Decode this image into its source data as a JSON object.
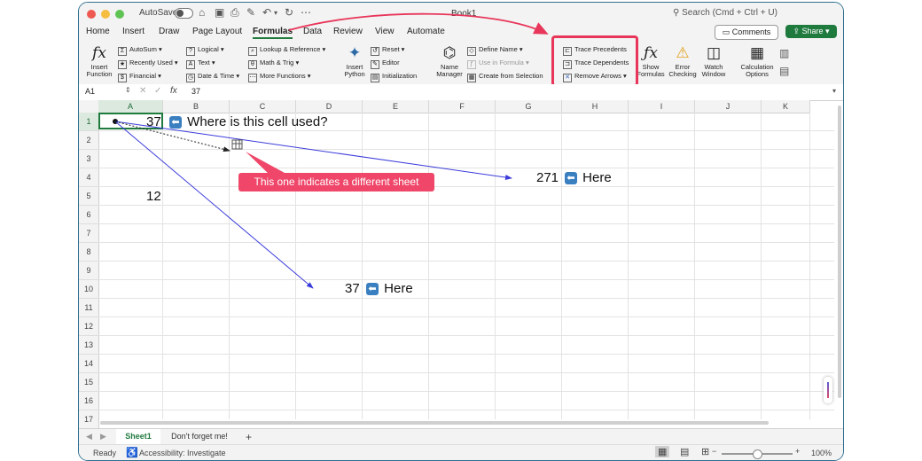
{
  "window": {
    "title": "Book1",
    "autosave_label": "AutoSave",
    "search_placeholder": "Search (Cmd + Ctrl + U)"
  },
  "tabs": [
    "Home",
    "Insert",
    "Draw",
    "Page Layout",
    "Formulas",
    "Data",
    "Review",
    "View",
    "Automate"
  ],
  "active_tab": "Formulas",
  "comments_label": "Comments",
  "share_label": "Share",
  "ribbon": {
    "insert_function": [
      "Insert",
      "Function"
    ],
    "lib_col1": [
      "AutoSum",
      "Recently Used",
      "Financial"
    ],
    "lib_col2": [
      "Logical",
      "Text",
      "Date & Time"
    ],
    "lib_col3": [
      "Lookup & Reference",
      "Math & Trig",
      "More Functions"
    ],
    "insert_python": [
      "Insert",
      "Python"
    ],
    "python_items": [
      "Reset",
      "Editor",
      "Initialization"
    ],
    "name_manager": [
      "Name",
      "Manager"
    ],
    "names_items": [
      "Define Name",
      "Use in Formula",
      "Create from Selection"
    ],
    "audit_items": [
      "Trace Precedents",
      "Trace Dependents",
      "Remove Arrows"
    ],
    "show_formulas": [
      "Show",
      "Formulas"
    ],
    "error_checking": [
      "Error",
      "Checking"
    ],
    "watch_window": [
      "Watch",
      "Window"
    ],
    "calc_options": [
      "Calculation",
      "Options"
    ]
  },
  "formula_bar": {
    "name_box": "A1",
    "fx": "fx",
    "value": "37"
  },
  "columns": [
    "A",
    "B",
    "C",
    "D",
    "E",
    "F",
    "G",
    "H",
    "I",
    "J",
    "K"
  ],
  "rows": [
    "1",
    "2",
    "3",
    "4",
    "5",
    "6",
    "7",
    "8",
    "9",
    "10",
    "11",
    "12",
    "13",
    "14",
    "15",
    "16",
    "17"
  ],
  "cells": {
    "a1_value": "37",
    "a1_note": "Where is this cell used?",
    "a5_value": "12",
    "g4_value": "271",
    "g4_note": "Here",
    "d10_value": "37",
    "d10_note": "Here"
  },
  "callout": "This one indicates a different sheet",
  "sheets": [
    "Sheet1",
    "Don't forget me!"
  ],
  "active_sheet": "Sheet1",
  "status": {
    "ready": "Ready",
    "accessibility": "Accessibility: Investigate",
    "zoom": "100%",
    "zoom_level": 0.5
  },
  "colors": {
    "accent": "#1f7a3e",
    "highlight": "#e8365a",
    "callout": "#ef4669",
    "trace_arrow": "#3b3bdc"
  }
}
